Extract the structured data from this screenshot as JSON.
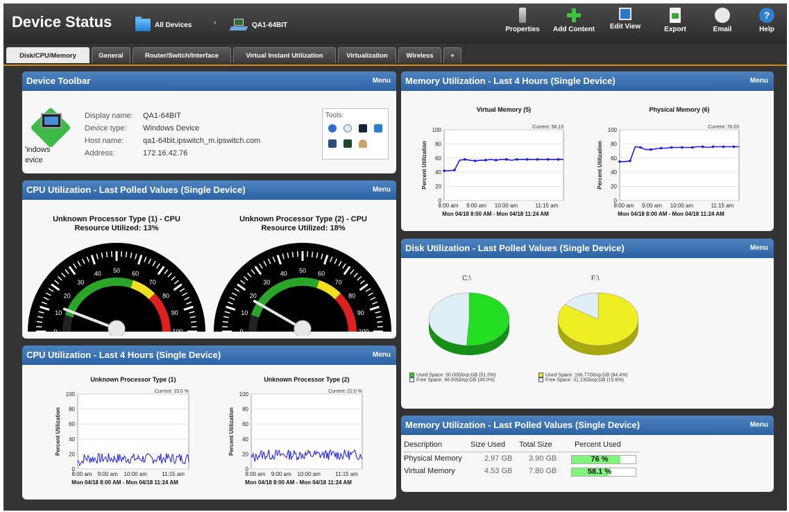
{
  "header": {
    "title": "Device Status",
    "breadcrumb": [
      {
        "label": "All Devices",
        "icon": "folder-icon"
      },
      {
        "label": "QA1-64BIT",
        "icon": "device-icon"
      }
    ],
    "breadcrumb_separator": "›",
    "toolbar": [
      {
        "label": "Properties",
        "icon": "properties-icon"
      },
      {
        "label": "Add Content",
        "icon": "add-icon"
      },
      {
        "label": "Edit View",
        "icon": "edit-icon"
      },
      {
        "label": "Export",
        "icon": "export-icon"
      },
      {
        "label": "Email",
        "icon": "email-icon"
      },
      {
        "label": "Help",
        "icon": "help-icon"
      }
    ]
  },
  "tabs": [
    {
      "label": "Disk/CPU/Memory",
      "active": true
    },
    {
      "label": "General"
    },
    {
      "label": "Router/Switch/Interface"
    },
    {
      "label": "Virtual Instant Utilization"
    },
    {
      "label": "Virtualization"
    },
    {
      "label": "Wireless"
    },
    {
      "label": "+"
    }
  ],
  "menu_label": "Menu",
  "device_toolbar": {
    "title": "Device Toolbar",
    "icon_label": "'indows\nevice",
    "fields": [
      {
        "key": "Display name:",
        "value": "QA1-64BIT"
      },
      {
        "key": "Device type:",
        "value": "Windows Device"
      },
      {
        "key": "Host name:",
        "value": "qa1-64bit.ipswitch_m.ipswitch.com"
      },
      {
        "key": "Address:",
        "value": "172.16.42.76"
      }
    ],
    "tools_label": "Tools:"
  },
  "cpu_polled": {
    "title": "CPU Utilization - Last Polled Values (Single Device)",
    "gauges": [
      {
        "title_line1": "Unknown Processor Type (1) - CPU",
        "title_line2": "Resource Utilized: 13%",
        "value": 13
      },
      {
        "title_line1": "Unknown Processor Type (2) - CPU",
        "title_line2": "Resource Utilized: 18%",
        "value": 18
      }
    ],
    "scale": [
      "0",
      "10",
      "20",
      "30",
      "40",
      "50",
      "60",
      "70",
      "80",
      "90",
      "100"
    ],
    "scale_max": 100
  },
  "cpu_4h": {
    "title": "CPU Utilization - Last 4 Hours (Single Device)",
    "charts": [
      {
        "title": "Unknown Processor Type (1)",
        "current": "Current: 15.0 %"
      },
      {
        "title": "Unknown Processor Type (2)",
        "current": "Current: 22.0 %"
      }
    ],
    "ylabel": "Percent Utilization",
    "yticks": [
      "100",
      "80",
      "60",
      "40",
      "20",
      "0"
    ],
    "xticks": [
      "8:00 am",
      "9:00 am",
      "10:00 am",
      "11:15 am"
    ],
    "range": "Mon 04/18 8:00 AM - Mon 04/18 11:24 AM"
  },
  "mem_4h": {
    "title": "Memory Utilization - Last 4 Hours (Single Device)",
    "charts": [
      {
        "title": "Virtual Memory (5)",
        "current": "Current: 58.13"
      },
      {
        "title": "Physical Memory (6)",
        "current": "Current: 76.03"
      }
    ],
    "ylabel": "Percent Utilization",
    "yticks": [
      "100",
      "80",
      "60",
      "40",
      "20",
      "0"
    ],
    "xticks": [
      "8:00 am",
      "9:00 am",
      "10:00 am",
      "11:15 am"
    ],
    "range": "Mon 04/18 8:00 AM - Mon 04/18 11:24 AM"
  },
  "disk": {
    "title": "Disk Utilization - Last Polled Values (Single Device)",
    "drives": [
      {
        "label": "C:\\",
        "used_pct": 51.0,
        "used_color": "#22dd22",
        "legend_used": "Used Space: 50.00Gbsp;GB (51.0%)",
        "legend_free": "Free Space: 48.00Gbsp;GB (49.0%)"
      },
      {
        "label": "F:\\",
        "used_pct": 84.4,
        "used_color": "#eeee22",
        "legend_used": "Used Space: 166.77Gbsp;GB (84.4%)",
        "legend_free": "Free Space: 31.23Gbsp;GB (15.6%)"
      }
    ],
    "free_color": "#dfeff5"
  },
  "mem_polled": {
    "title": "Memory Utilization - Last Polled Values (Single Device)",
    "columns": [
      "Description",
      "Size Used",
      "Total Size",
      "Percent Used"
    ],
    "rows": [
      {
        "description": "Physical Memory",
        "size_used": "2.97 GB",
        "total_size": "3.90 GB",
        "percent_label": "76 %",
        "percent": 76
      },
      {
        "description": "Virtual Memory",
        "size_used": "4.53 GB",
        "total_size": "7.80 GB",
        "percent_label": "58.1 %",
        "percent": 58.1
      }
    ]
  },
  "colors": {
    "panel_header": "#2d62a2",
    "chart_line": "#1a1ae8",
    "gauge_green": "#2aa52a",
    "gauge_yellow": "#f0e020",
    "gauge_red": "#e02020"
  }
}
